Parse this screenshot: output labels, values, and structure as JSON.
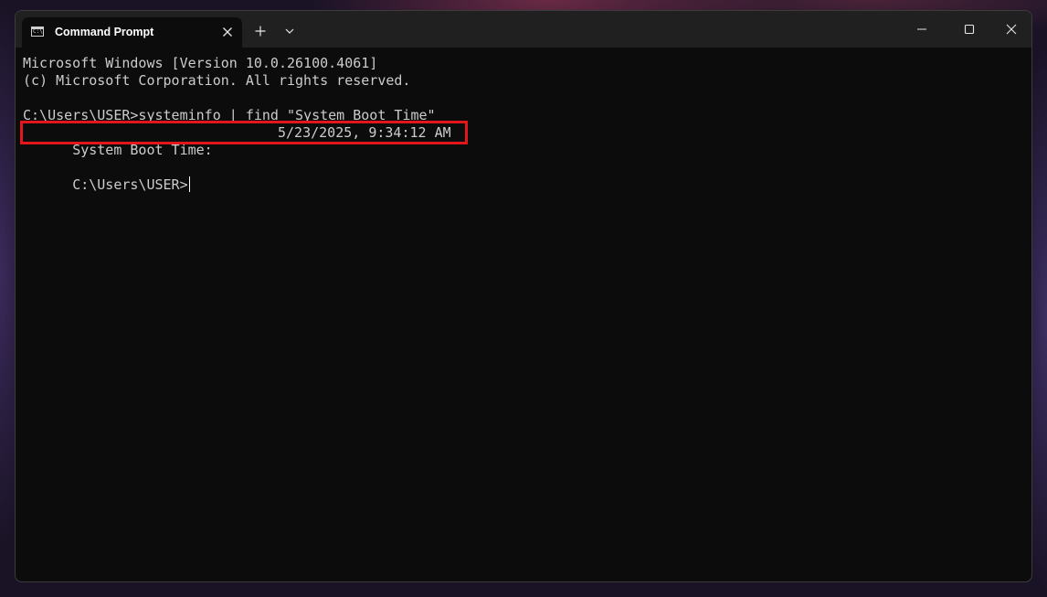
{
  "window": {
    "tab_title": "Command Prompt",
    "tab_icon_glyph": "C:\\"
  },
  "terminal": {
    "lines": [
      "Microsoft Windows [Version 10.0.26100.4061]",
      "(c) Microsoft Corporation. All rights reserved.",
      "C:\\Users\\USER>systeminfo | find \"System Boot Time\""
    ],
    "boot_label": "System Boot Time:",
    "boot_value": "5/23/2025, 9:34:12 AM",
    "prompt": "C:\\Users\\USER>"
  },
  "icons": {
    "tab": "cmd-icon",
    "tab_close": "close-icon",
    "new_tab": "plus-icon",
    "dropdown": "chevron-down-icon",
    "minimize": "minimize-icon",
    "maximize": "maximize-icon",
    "close": "close-icon"
  },
  "colors": {
    "terminal_bg": "#0c0c0c",
    "terminal_text": "#cccccc",
    "titlebar_bg": "#202020",
    "highlight_border": "#e3161b"
  }
}
